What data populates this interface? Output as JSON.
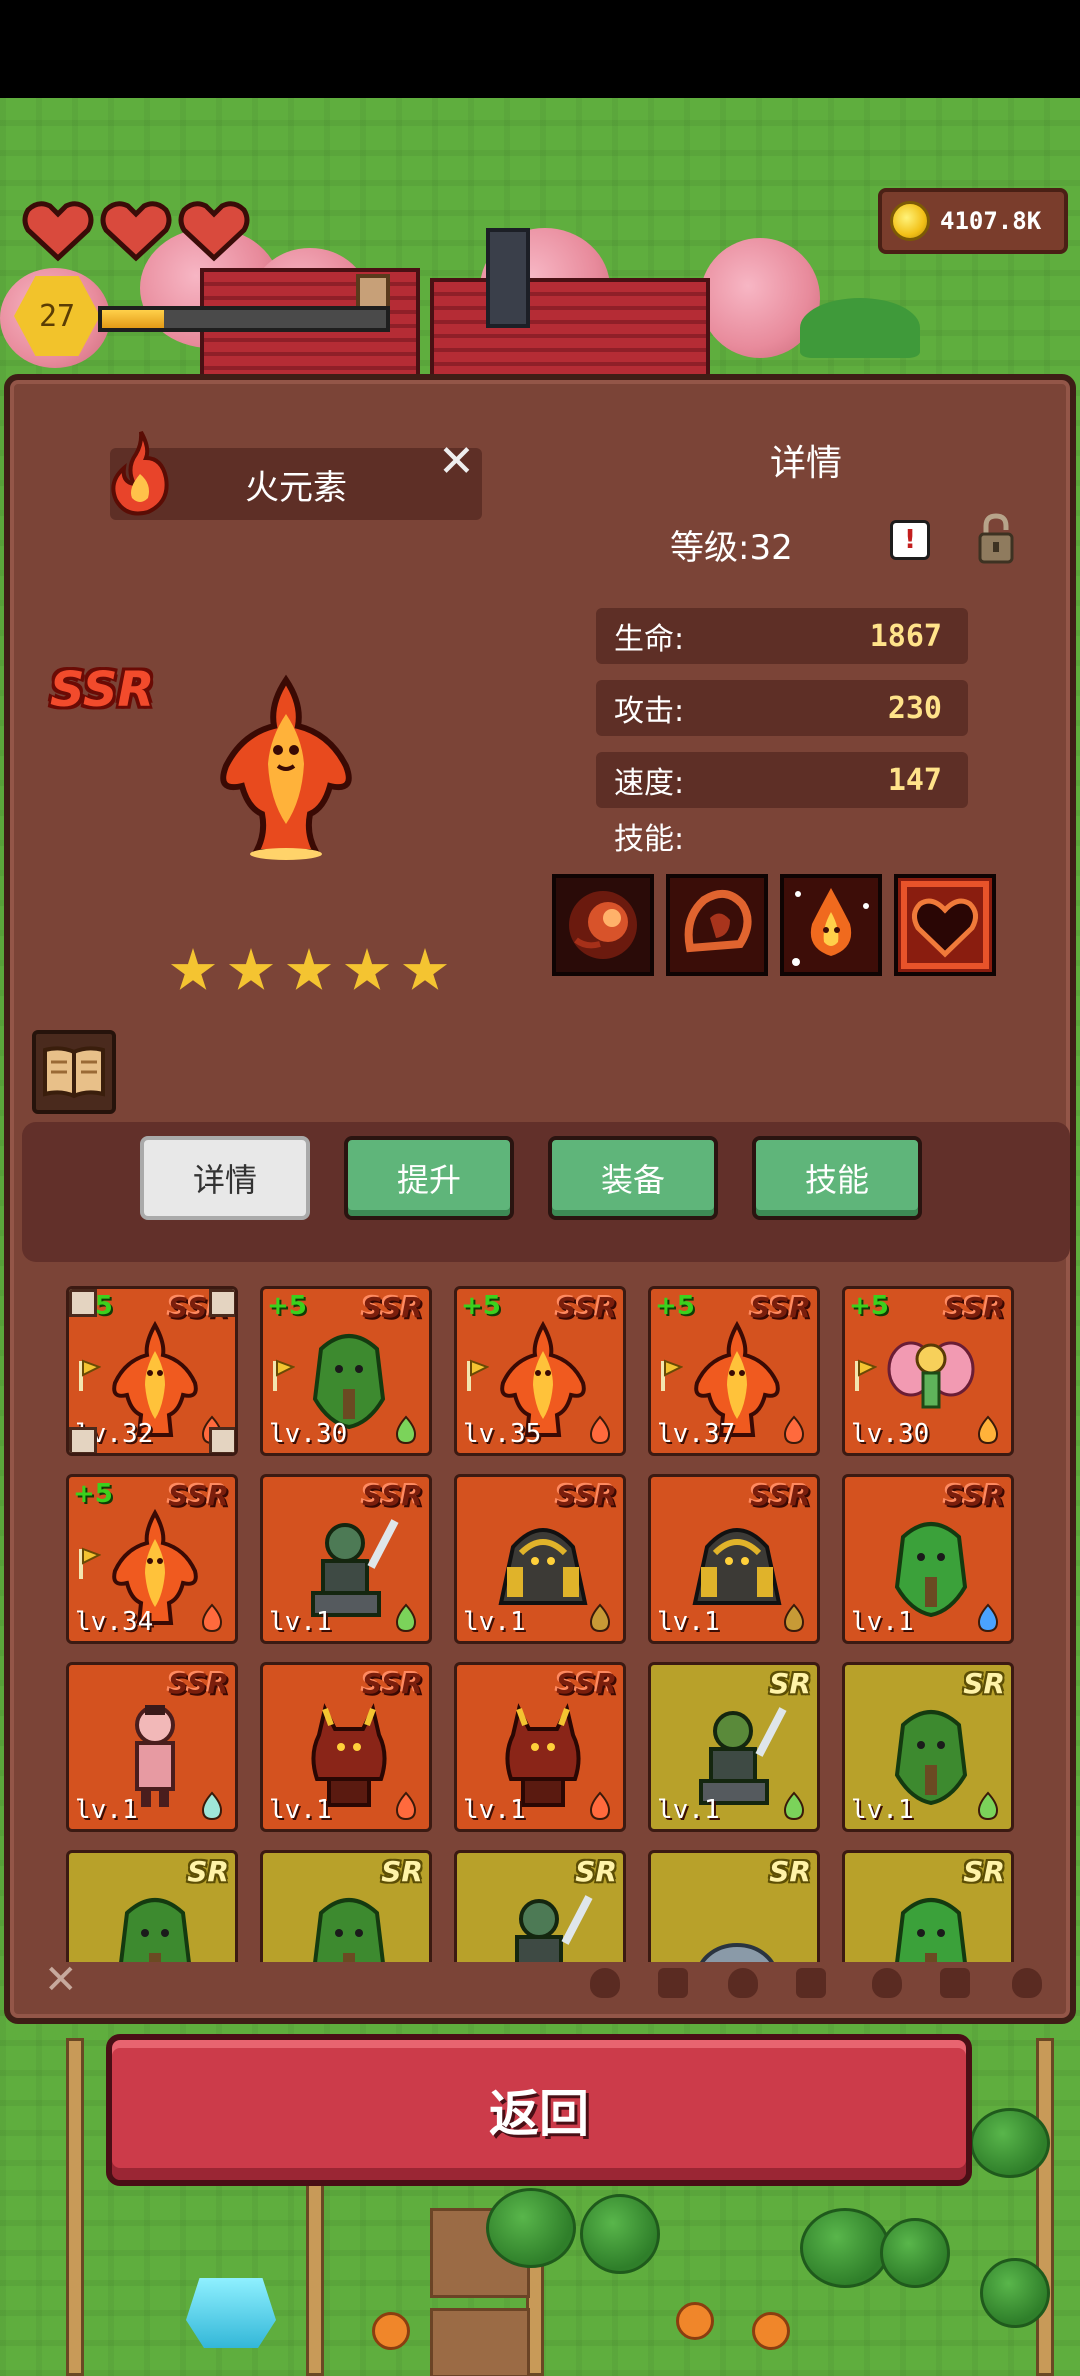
{
  "hud": {
    "hearts": 3,
    "player_level": "27",
    "xp_fraction": 0.22,
    "coins": "4107.8K"
  },
  "hero": {
    "name": "火元素",
    "rarity": "SSR",
    "stars": 5,
    "details_title": "详情",
    "level_text": "等级:32",
    "stats": [
      {
        "label": "生命:",
        "value": "1867"
      },
      {
        "label": "攻击:",
        "value": "230"
      },
      {
        "label": "速度:",
        "value": "147"
      }
    ],
    "skills_label": "技能:",
    "skill_icons": [
      "fireball-skill-icon",
      "flame-fist-skill-icon",
      "campfire-skill-icon",
      "fire-heart-skill-icon"
    ]
  },
  "tabs": [
    {
      "label": "详情",
      "active": true
    },
    {
      "label": "提升",
      "active": false
    },
    {
      "label": "装备",
      "active": false
    },
    {
      "label": "技能",
      "active": false
    }
  ],
  "roster": [
    {
      "plus": "+5",
      "rarity": "SSR",
      "level": "lv.32",
      "sprite": "fire-elemental",
      "element": "fire",
      "flag": true,
      "selected": true
    },
    {
      "plus": "+5",
      "rarity": "SSR",
      "level": "lv.30",
      "sprite": "treant",
      "element": "leaf",
      "flag": true
    },
    {
      "plus": "+5",
      "rarity": "SSR",
      "level": "lv.35",
      "sprite": "fire-elemental",
      "element": "fire",
      "flag": true
    },
    {
      "plus": "+5",
      "rarity": "SSR",
      "level": "lv.37",
      "sprite": "fire-elemental",
      "element": "fire",
      "flag": true
    },
    {
      "plus": "+5",
      "rarity": "SSR",
      "level": "lv.30",
      "sprite": "fairy",
      "element": "sun",
      "flag": true
    },
    {
      "plus": "+5",
      "rarity": "SSR",
      "level": "lv.34",
      "sprite": "fire-elemental",
      "element": "fire",
      "flag": true
    },
    {
      "plus": "",
      "rarity": "SSR",
      "level": "lv.1",
      "sprite": "orc-rider",
      "element": "leaf",
      "flag": false
    },
    {
      "plus": "",
      "rarity": "SSR",
      "level": "lv.1",
      "sprite": "rock-golem",
      "element": "earth",
      "flag": false
    },
    {
      "plus": "",
      "rarity": "SSR",
      "level": "lv.1",
      "sprite": "rock-golem",
      "element": "earth",
      "flag": false
    },
    {
      "plus": "",
      "rarity": "SSR",
      "level": "lv.1",
      "sprite": "slime-golem",
      "element": "water",
      "flag": false
    },
    {
      "plus": "",
      "rarity": "SSR",
      "level": "lv.1",
      "sprite": "pink-monk",
      "element": "wind",
      "flag": false
    },
    {
      "plus": "",
      "rarity": "SSR",
      "level": "lv.1",
      "sprite": "horned-demon",
      "element": "fire",
      "flag": false
    },
    {
      "plus": "",
      "rarity": "SSR",
      "level": "lv.1",
      "sprite": "horned-demon",
      "element": "fire",
      "flag": false
    },
    {
      "plus": "",
      "rarity": "SR",
      "level": "lv.1",
      "sprite": "orc-axe",
      "element": "leaf",
      "flag": false
    },
    {
      "plus": "",
      "rarity": "SR",
      "level": "lv.1",
      "sprite": "treant",
      "element": "leaf",
      "flag": false
    },
    {
      "plus": "",
      "rarity": "SR",
      "level": "",
      "sprite": "treant",
      "element": "",
      "flag": false
    },
    {
      "plus": "",
      "rarity": "SR",
      "level": "",
      "sprite": "treant",
      "element": "",
      "flag": false
    },
    {
      "plus": "",
      "rarity": "SR",
      "level": "",
      "sprite": "orc-rider",
      "element": "",
      "flag": false
    },
    {
      "plus": "",
      "rarity": "SR",
      "level": "",
      "sprite": "stone-blob",
      "element": "",
      "flag": false
    },
    {
      "plus": "",
      "rarity": "SR",
      "level": "",
      "sprite": "slime-golem",
      "element": "",
      "flag": false
    }
  ],
  "filter_icons": [
    "fire-filter-icon",
    "earth-filter-icon",
    "water-filter-icon",
    "wind-filter-icon",
    "flame-filter-icon",
    "gear-filter-icon",
    "cycle-filter-icon"
  ],
  "back_label": "返回",
  "colors": {
    "panel": "#7b4437",
    "ssr_card": "#d4521f",
    "sr_card": "#b8a12a",
    "tab_green": "#5fb57a",
    "back_button": "#cc3b4a",
    "stat_value": "#ffe38a"
  }
}
